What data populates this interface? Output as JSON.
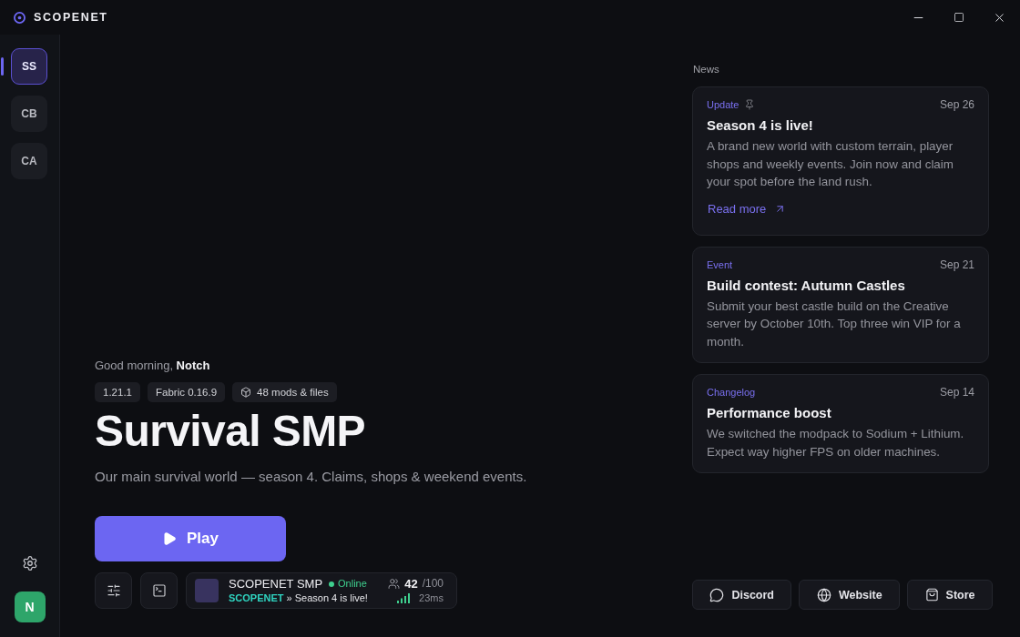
{
  "window": {
    "title": "SCOPENET"
  },
  "sidebar": {
    "servers": [
      {
        "initials": "SS",
        "selected": true
      },
      {
        "initials": "CB",
        "selected": false
      },
      {
        "initials": "CA",
        "selected": false
      }
    ],
    "user": {
      "initial": "N"
    }
  },
  "hero": {
    "greeting": "Good morning, **Notch**",
    "tags": [
      {
        "kind": "text",
        "label": "1.21.1"
      },
      {
        "kind": "text",
        "label": "Fabric 0.16.9"
      },
      {
        "kind": "mods",
        "label": "48 mods & files"
      }
    ],
    "title": "Survival SMP",
    "description": "Our main survival world — season 4. Claims, shops & weekend events.",
    "play_button": "Play"
  },
  "server": {
    "name": "SCOPENET SMP",
    "online": true,
    "status": "Online",
    "motd_brand": "SCOPENET",
    "motd_text": "» Season 4 is live!",
    "players": "42",
    "max_players": "/100",
    "ping": "23ms"
  },
  "news": {
    "heading": "News",
    "items": [
      {
        "category": "Update",
        "pinned": true,
        "date": "Sep 26",
        "title": "Season 4 is live!",
        "body": "A brand new world with custom terrain, player shops and weekly events. Join now and claim your spot before the land rush.",
        "link": "Read more"
      },
      {
        "category": "Event",
        "pinned": false,
        "date": "Sep 21",
        "title": "Build contest: Autumn Castles",
        "body": "Submit your best castle build on the Creative server by October 10th. Top three win VIP for a month."
      },
      {
        "category": "Changelog",
        "pinned": false,
        "date": "Sep 14",
        "title": "Performance boost",
        "body": "We switched the modpack to Sodium + Lithium. Expect way higher FPS on older machines."
      }
    ]
  },
  "links": [
    {
      "kind": "discord",
      "label": "Discord"
    },
    {
      "kind": "website",
      "label": "Website"
    },
    {
      "kind": "store",
      "label": "Store"
    }
  ]
}
